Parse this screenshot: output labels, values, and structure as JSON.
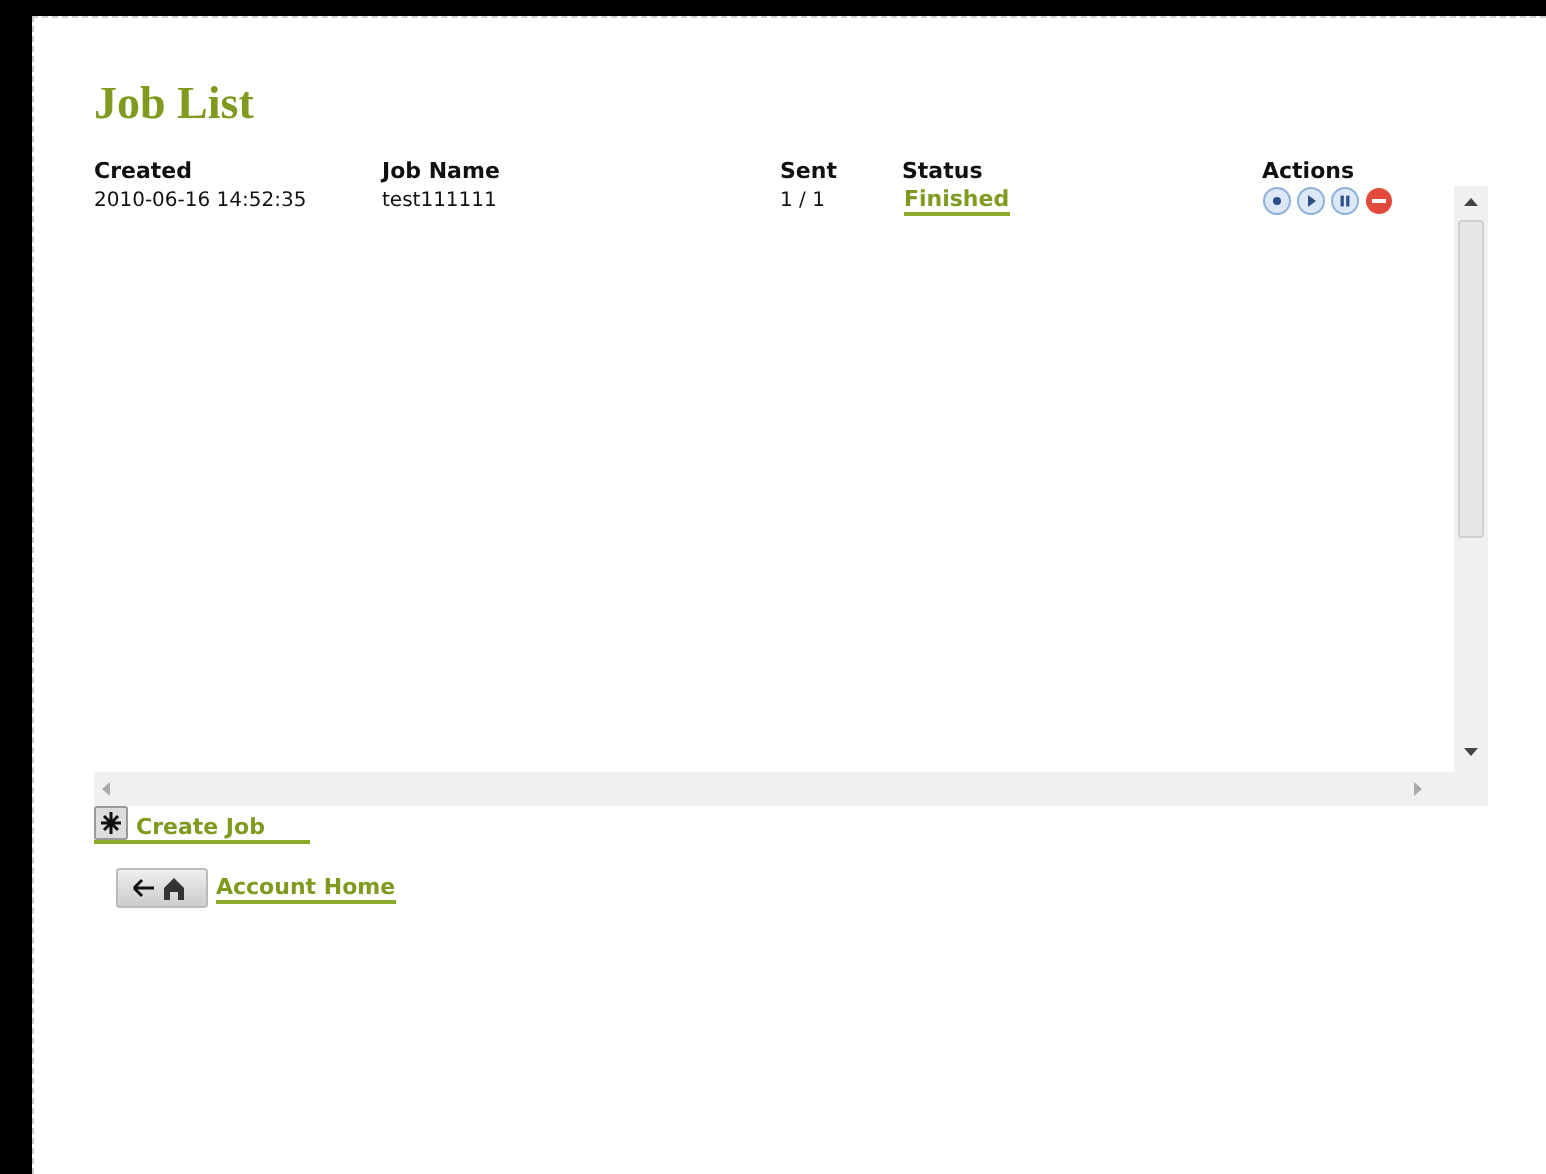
{
  "title": "Job List",
  "columns": [
    "Created",
    "Job Name",
    "Sent",
    "Status",
    "Actions"
  ],
  "rows": [
    {
      "created": "2010-06-16 14:52:35",
      "job_name": "test111111",
      "sent": "1 / 1",
      "status": "Finished"
    }
  ],
  "create_job": {
    "label": "Create Job"
  },
  "account_home": {
    "label": "Account Home"
  }
}
